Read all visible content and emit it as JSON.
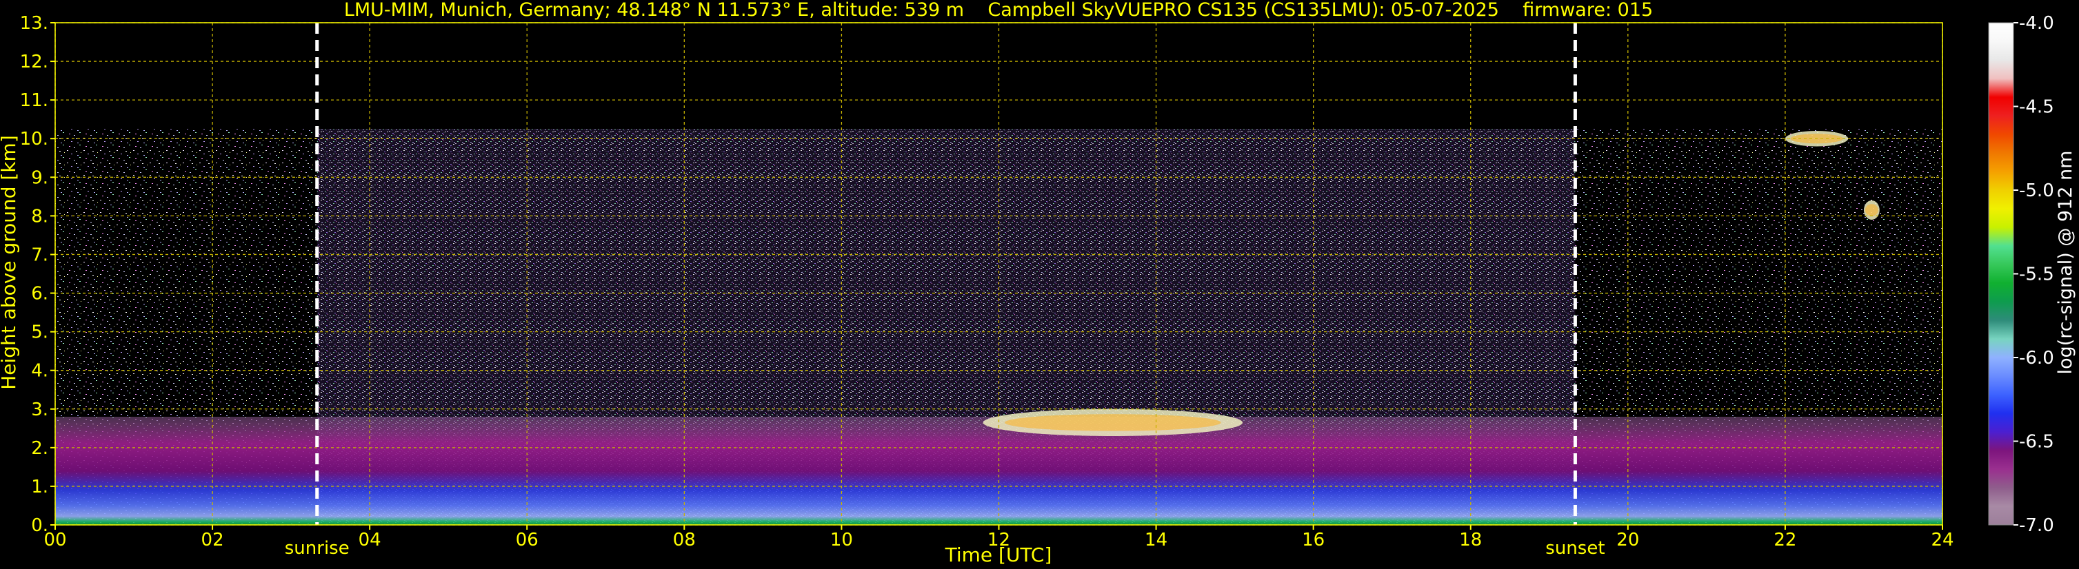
{
  "chart_data": {
    "type": "heatmap",
    "title": "LMU-MIM, Munich, Germany; 48.148° N 11.573° E, altitude: 539 m    Campbell SkyVUEPRO CS135 (CS135LMU): 05-07-2025    firmware: 015",
    "xlabel": "Time [UTC]",
    "ylabel": "Height above ground [km]",
    "xlim": [
      0,
      24
    ],
    "ylim": [
      0,
      13
    ],
    "x_ticks": [
      "00",
      "02",
      "04",
      "06",
      "08",
      "10",
      "12",
      "14",
      "16",
      "18",
      "20",
      "22",
      "24"
    ],
    "y_ticks": [
      "0.",
      "1.",
      "2.",
      "3.",
      "4.",
      "5.",
      "6.",
      "7.",
      "8.",
      "9.",
      "10.",
      "11.",
      "12.",
      "13."
    ],
    "grid": true,
    "markers": [
      {
        "label": "sunrise",
        "x": 3.33
      },
      {
        "label": "sunset",
        "x": 19.33
      }
    ],
    "colorbar": {
      "label": "log(rc-signal) @ 912 nm",
      "ticks": [
        "-4.0",
        "-4.5",
        "-5.0",
        "-5.5",
        "-6.0",
        "-6.5",
        "-7.0"
      ],
      "range": [
        -7.0,
        -4.0
      ],
      "colors": [
        "#9c7f9a",
        "#a88aa5",
        "#8f5d8c",
        "#9a2f8f",
        "#7d157d",
        "#4b1fd0",
        "#2030f0",
        "#3d62ff",
        "#6a8cff",
        "#8fb1ff",
        "#78d4c0",
        "#2e8c7a",
        "#0e9c4e",
        "#10b030",
        "#36c85a",
        "#52e090",
        "#c8f000",
        "#f0f000",
        "#f0d000",
        "#f5a000",
        "#f07800",
        "#f04800",
        "#ee2020",
        "#f00000",
        "#f0c0c0",
        "#e8e8e8",
        "#f8f8f8",
        "#ffffff"
      ]
    },
    "layers": [
      {
        "name": "noise",
        "x": [
          0,
          24
        ],
        "y": [
          0,
          10.25
        ]
      },
      {
        "name": "boundary-layer",
        "x": [
          0,
          24
        ],
        "y": [
          0,
          2.8
        ]
      },
      {
        "name": "cloud",
        "x": [
          11.8,
          15.1
        ],
        "y": [
          2.3,
          3.0
        ]
      },
      {
        "name": "cloud",
        "x": [
          22.0,
          22.8
        ],
        "y": [
          9.8,
          10.2
        ]
      },
      {
        "name": "cloud",
        "x": [
          23.0,
          23.2
        ],
        "y": [
          7.9,
          8.4
        ]
      }
    ]
  }
}
